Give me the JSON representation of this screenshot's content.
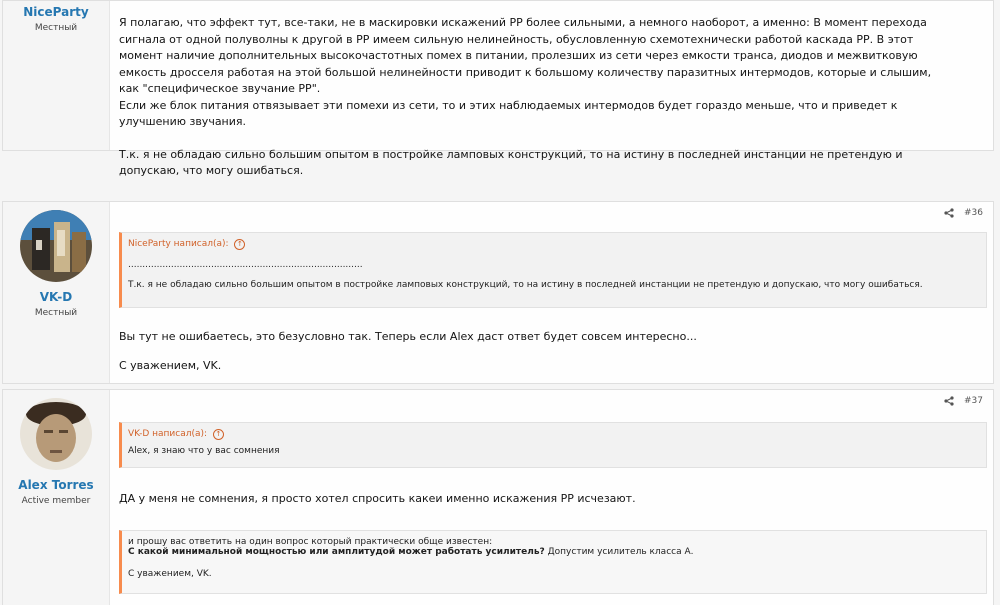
{
  "posts": [
    {
      "author": "NiceParty",
      "role": "Местный",
      "paragraphs": [
        "Я полагаю, что эффект тут, все-таки, не в маскировки искажений РР более сильными, а немного наоборот, а именно: В момент перехода сигнала от одной полуволны к другой в РР имеем сильную нелинейность, обусловленную схемотехнически работой каскада РР. В этот момент наличие дополнительных высокочастотных помех в питании, пролезших из сети через емкости транса, диодов и межвитковую емкость дросселя работая на этой большой нелинейности приводит к большому количеству паразитных интермодов, которые и слышим, как \"специфическое звучание РР\".",
        "Если же блок питания отвязывает эти помехи из сети, то и этих наблюдаемых интермодов будет гораздо меньше, что и приведет к улучшению звучания.",
        "Т.к. я не обладаю сильно большим опытом в постройке ламповых конструкций, то на истину в последней инстанции не претендую и допускаю, что могу ошибаться."
      ]
    },
    {
      "author": "VK-D",
      "role": "Местный",
      "number": "#36",
      "quote_head": "NiceParty написал(а):",
      "quote_lines": [
        "..................................................................................",
        "Т.к. я не обладаю сильно большим опытом в постройке ламповых конструкций, то на истину в последней инстанции не претендую и допускаю, что могу ошибаться."
      ],
      "paragraphs": [
        "Вы тут не ошибаетесь, это безусловно так. Теперь если Alex даст ответ будет совсем интересно...",
        "С уважением, VK."
      ]
    },
    {
      "author": "Alex Torres",
      "role": "Active member",
      "number": "#37",
      "quote_head": "VK-D написал(а):",
      "quote_lines": [
        "Alex, я знаю что у вас сомнения"
      ],
      "paragraphs": [
        "ДА у меня не сомнения, я просто хотел спросить какеи именно искажения РР исчезают."
      ],
      "quote2_lines": [
        "и прошу вас ответить на один вопрос который практически обще известен:",
        "С какой минимальной мощностью или амплитудой может работать усилитель?",
        " Допустим усилитель класса А.",
        "С уважением, VK."
      ]
    }
  ],
  "colors": {
    "accent": "#2577b1",
    "quote_border": "#f78b4d",
    "quote_head": "#d1622a"
  },
  "icons": {
    "share": "share-icon",
    "up_arrow": "arrow-up-circle-icon"
  }
}
